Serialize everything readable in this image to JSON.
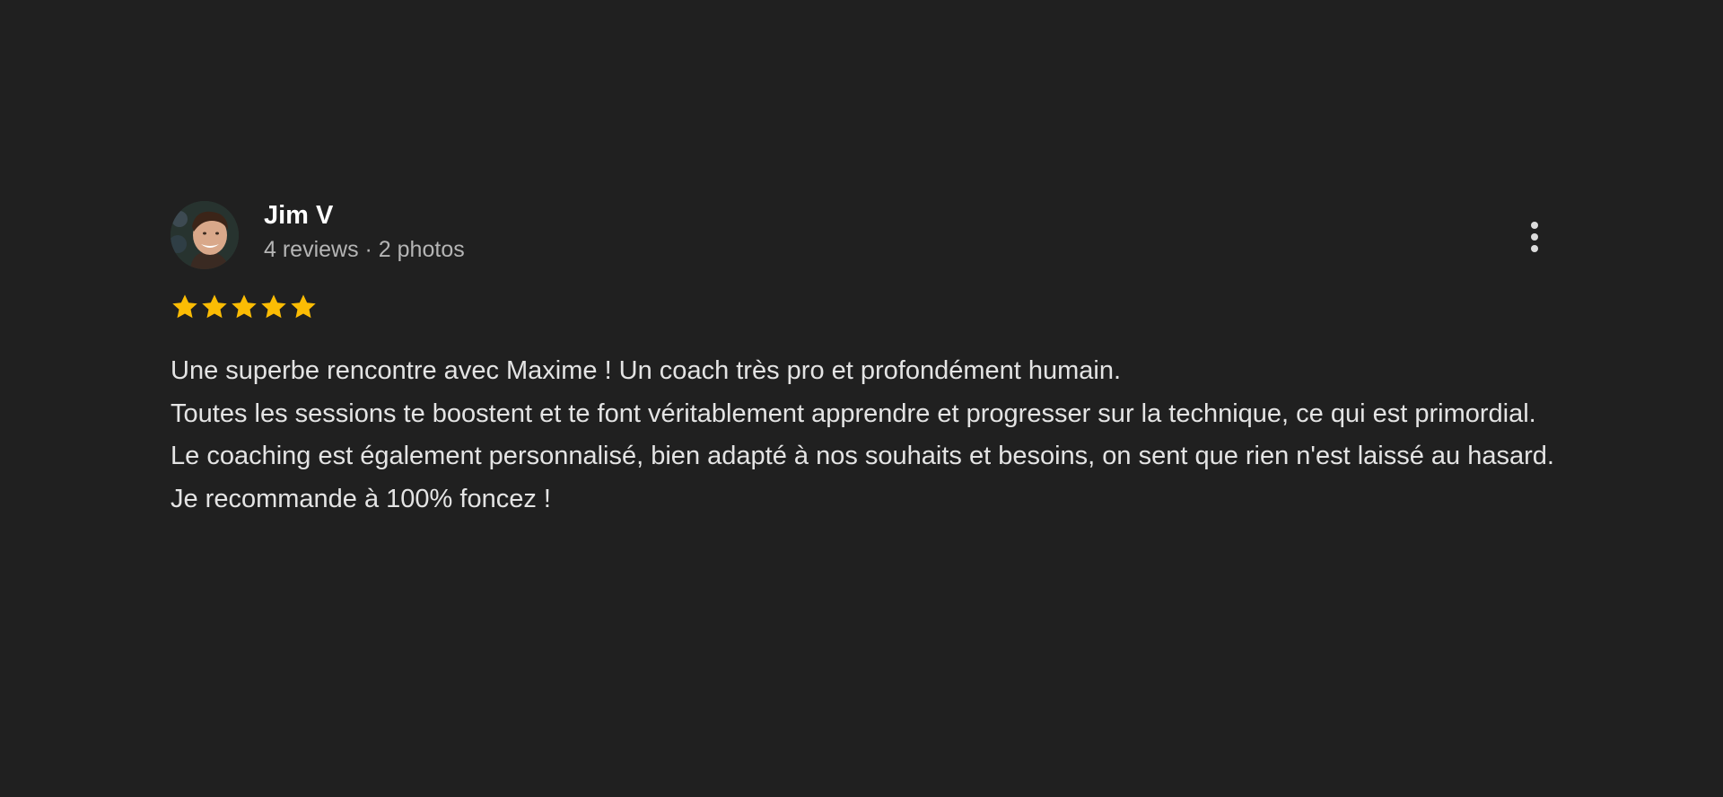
{
  "review": {
    "reviewer": {
      "name": "Jim V",
      "meta": "4 reviews · 2 photos",
      "avatar_icon": "avatar-photo"
    },
    "menu_icon": "more-vert-icon",
    "rating": 5,
    "rating_max": 5,
    "star_color": "#fbbc04",
    "paragraphs": [
      "Une superbe rencontre avec Maxime ! Un coach très pro et profondément humain.",
      "Toutes les sessions te boostent et te font véritablement apprendre et progresser sur la technique, ce qui est primordial.",
      "Le coaching est également personnalisé, bien adapté à nos souhaits et besoins, on sent que rien n'est laissé au hasard.",
      "Je recommande à 100% foncez !"
    ]
  },
  "colors": {
    "background": "#202020",
    "name": "#ffffff",
    "meta": "#b5b5b5",
    "body_text": "#e4e4e4"
  }
}
